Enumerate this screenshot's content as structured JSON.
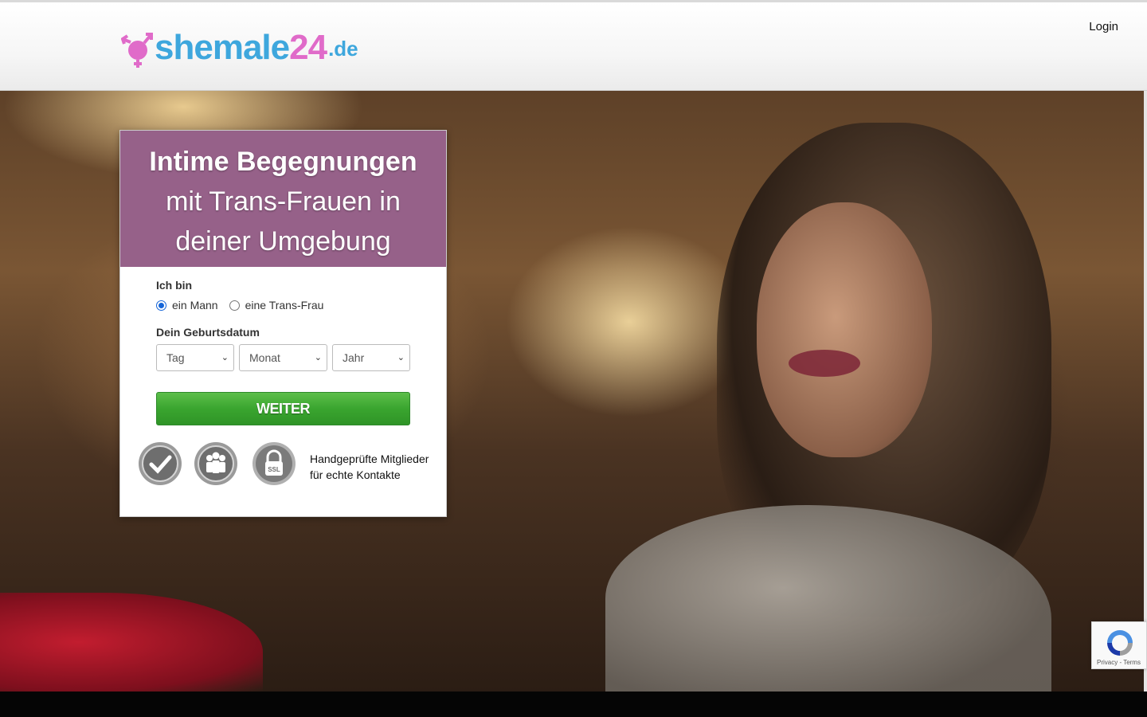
{
  "brand": {
    "logo_main": "shemale",
    "logo_num": "24",
    "logo_tld": ".de"
  },
  "header": {
    "login": "Login"
  },
  "card": {
    "headline_bold": "Intime Begegnungen",
    "headline_rest_1": "mit Trans-Frauen in",
    "headline_rest_2": "deiner Umgebung"
  },
  "form": {
    "iam_label": "Ich bin",
    "options": [
      {
        "label": "ein Mann",
        "checked": true
      },
      {
        "label": "eine Trans-Frau",
        "checked": false
      }
    ],
    "dob_label": "Dein Geburtsdatum",
    "selects": {
      "day": "Tag",
      "month": "Monat",
      "year": "Jahr"
    },
    "submit": "WEITER"
  },
  "trust": {
    "text": "Handgeprüfte Mitglieder für echte Kontakte",
    "icons": [
      "check-seal-icon",
      "members-seal-icon",
      "ssl-lock-icon"
    ]
  },
  "recaptcha": {
    "footer": "Privacy - Terms"
  },
  "colors": {
    "card_header": "#966189",
    "button_green": "#3aa52f",
    "logo_blue": "#3ea7dd",
    "logo_pink": "#e06bc9"
  }
}
